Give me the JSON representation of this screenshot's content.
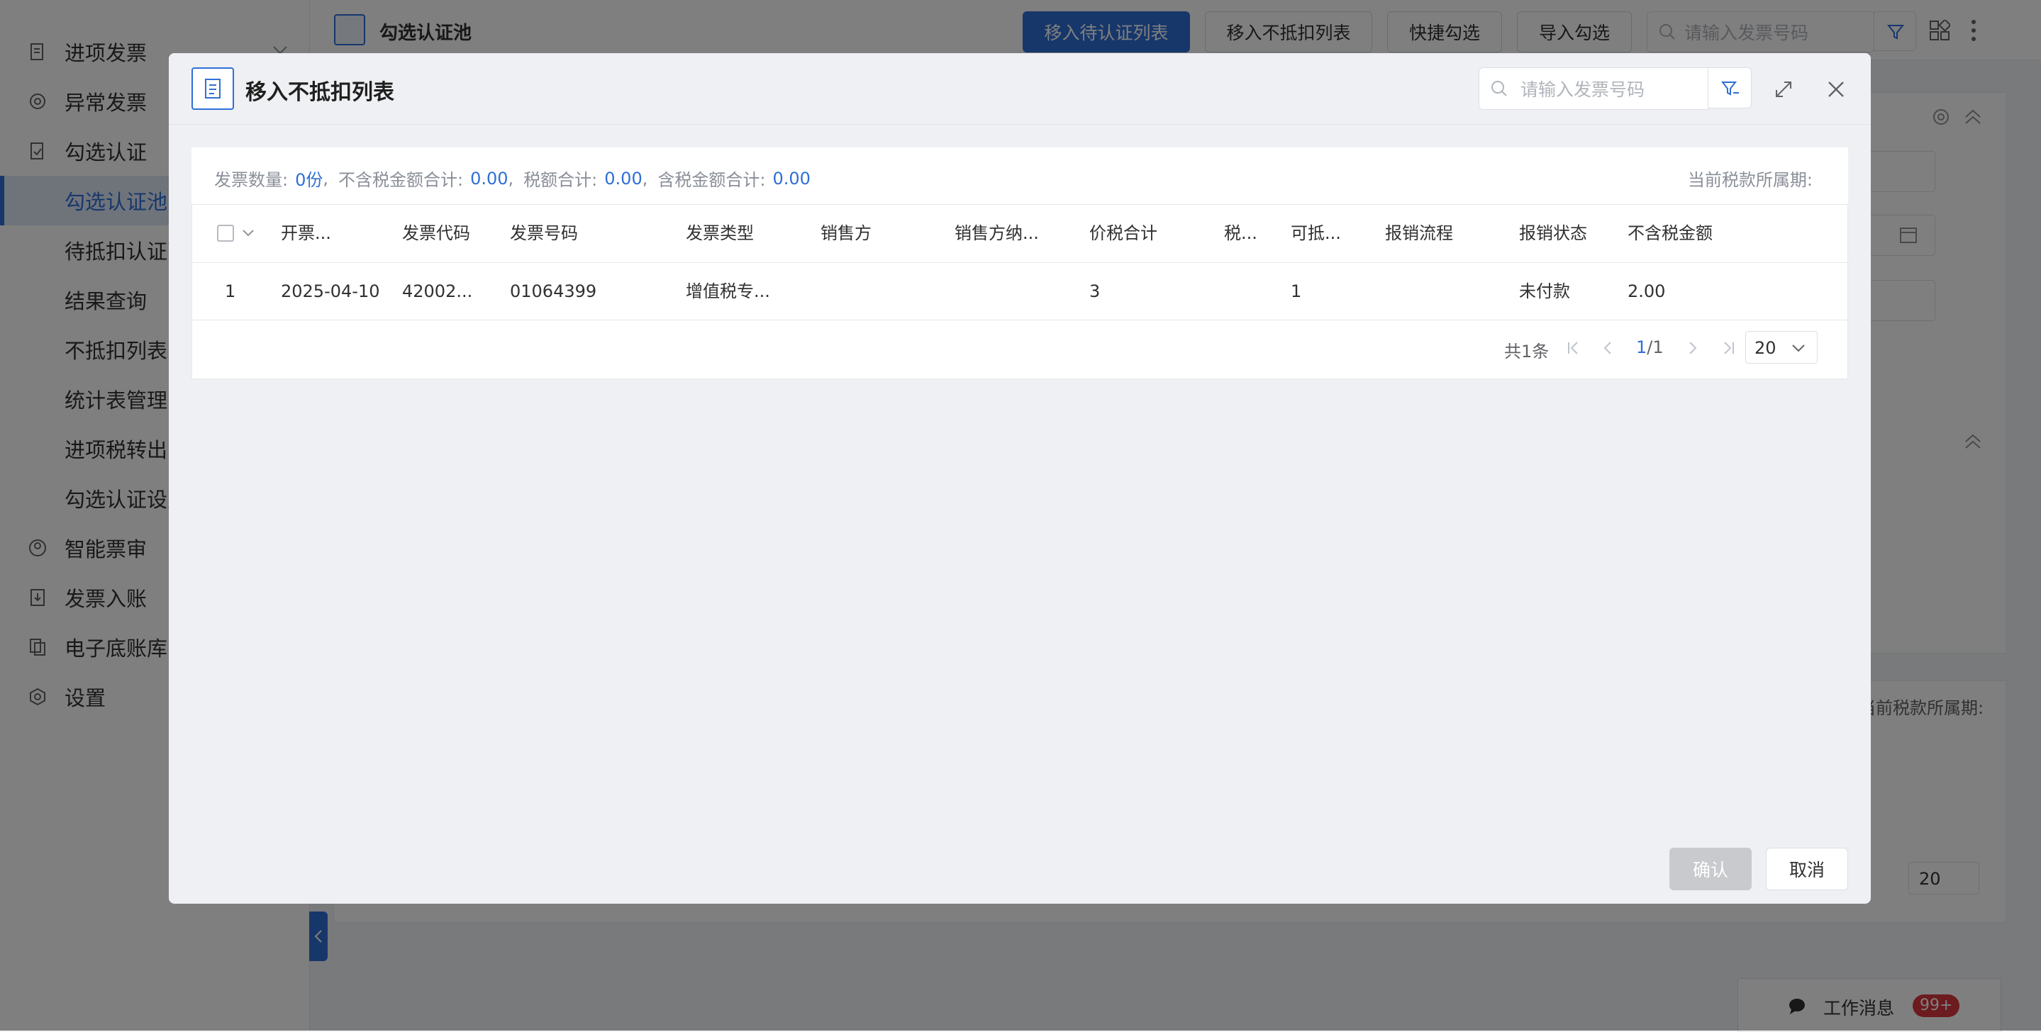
{
  "sidebar": {
    "items": [
      {
        "label": "进项发票",
        "icon": "invoice-icon"
      },
      {
        "label": "异常发票",
        "icon": "at-icon"
      },
      {
        "label": "勾选认证",
        "icon": "check-doc-icon"
      },
      {
        "label": "勾选认证池",
        "active": true
      },
      {
        "label": "待抵扣认证列表"
      },
      {
        "label": "结果查询"
      },
      {
        "label": "不抵扣列表"
      },
      {
        "label": "统计表管理"
      },
      {
        "label": "进项税转出"
      },
      {
        "label": "勾选认证设置"
      },
      {
        "label": "智能票审",
        "icon": "user-circle-icon"
      },
      {
        "label": "发票入账",
        "icon": "download-doc-icon"
      },
      {
        "label": "电子底账库",
        "icon": "copy-icon"
      },
      {
        "label": "设置",
        "icon": "gear-icon"
      }
    ]
  },
  "header": {
    "page_title": "勾选认证池",
    "buttons": [
      "移入待认证列表",
      "移入不抵扣列表",
      "快捷勾选",
      "导入勾选"
    ],
    "search_placeholder": "请输入发票号码"
  },
  "background": {
    "period_label": "当前税款所属期:",
    "page_size": "20"
  },
  "work_messages": {
    "label": "工作消息",
    "badge": "99+"
  },
  "modal": {
    "title": "移入不抵扣列表",
    "search_placeholder": "请输入发票号码",
    "summary": {
      "count_label": "发票数量:",
      "count_value": "0份",
      "excl_tax_label": "不含税金额合计:",
      "excl_tax_value": "0.00",
      "tax_label": "税额合计:",
      "tax_value": "0.00",
      "incl_tax_label": "含税金额合计:",
      "incl_tax_value": "0.00",
      "period_label": "当前税款所属期:",
      "sep": ","
    },
    "table": {
      "columns": [
        "开票...",
        "发票代码",
        "发票号码",
        "发票类型",
        "销售方",
        "销售方纳...",
        "价税合计",
        "税...",
        "可抵...",
        "报销流程",
        "报销状态",
        "不含税金额"
      ],
      "rows": [
        [
          "1",
          "2025-04-10",
          "42002...",
          "01064399",
          "增值税专...",
          "",
          "",
          "3",
          "",
          "1",
          "",
          "未付款",
          "2.00"
        ]
      ]
    },
    "pager": {
      "total": "共1条",
      "current": "1",
      "pages": "/1",
      "page_size": "20"
    },
    "confirm_label": "确认",
    "cancel_label": "取消"
  },
  "colors": {
    "primary": "#2f6fd6",
    "badge": "#d9363e"
  }
}
